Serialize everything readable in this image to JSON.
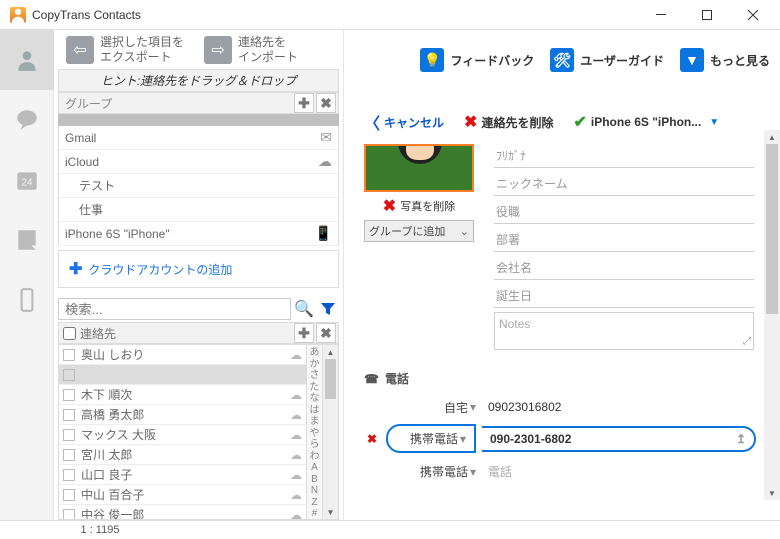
{
  "window": {
    "title": "CopyTrans Contacts"
  },
  "top": {
    "export": "選択した項目を\nエクスポート",
    "import": "連絡先を\nインポート",
    "feedback": "フィードバック",
    "guide": "ユーザーガイド",
    "more": "もっと見る"
  },
  "hint": "ヒント:連絡先をドラッグ＆ドロップ",
  "groups": {
    "header": "グループ",
    "items": [
      {
        "label": "Gmail",
        "icon": "mail"
      },
      {
        "label": "iCloud",
        "icon": "cloud"
      },
      {
        "label": "テスト",
        "indent": true
      },
      {
        "label": "仕事",
        "indent": true
      },
      {
        "label": "iPhone 6S \"iPhone\"",
        "icon": "phone"
      }
    ],
    "addCloud": "クラウドアカウントの追加"
  },
  "search": {
    "placeholder": "検索..."
  },
  "contacts": {
    "header": "連絡先",
    "items": [
      {
        "name": "奥山 しおり",
        "icon": "cloud"
      },
      {
        "name": "",
        "selected": true
      },
      {
        "name": "木下 順次",
        "icon": "cloud"
      },
      {
        "name": "高橋 勇太郎",
        "icon": "cloud"
      },
      {
        "name": "マックス 大阪",
        "icon": "cloud"
      },
      {
        "name": "宮川 太郎",
        "icon": "cloud"
      },
      {
        "name": "山口 良子",
        "icon": "cloud"
      },
      {
        "name": "中山 百合子",
        "icon": "cloud"
      },
      {
        "name": "中谷 俊一郎",
        "icon": "cloud"
      }
    ],
    "kana": [
      "あ",
      "か",
      "さ",
      "た",
      "な",
      "は",
      "ま",
      "や",
      "ら",
      "わ",
      "A",
      "B",
      "N",
      "Z",
      "#"
    ]
  },
  "actions": {
    "cancel": "キャンセル",
    "delete": "連絡先を削除",
    "save": "iPhone 6S \"iPhon..."
  },
  "detail": {
    "deletePhoto": "写真を削除",
    "groupAdd": "グループに追加",
    "fields": {
      "reading": "ﾌﾘｶﾞﾅ",
      "nickname": "ニックネーム",
      "title": "役職",
      "department": "部署",
      "company": "会社名",
      "birthday": "誕生日",
      "notes": "Notes"
    }
  },
  "phone": {
    "header": "電話",
    "rows": [
      {
        "label": "自宅",
        "value": "09023016802"
      },
      {
        "label": "携帯電話",
        "value": "090-2301-6802",
        "highlight": true,
        "deletable": true
      },
      {
        "label": "携帯電話",
        "value": "",
        "placeholder": "電話"
      }
    ]
  },
  "status": {
    "count": "1 : 1195"
  }
}
